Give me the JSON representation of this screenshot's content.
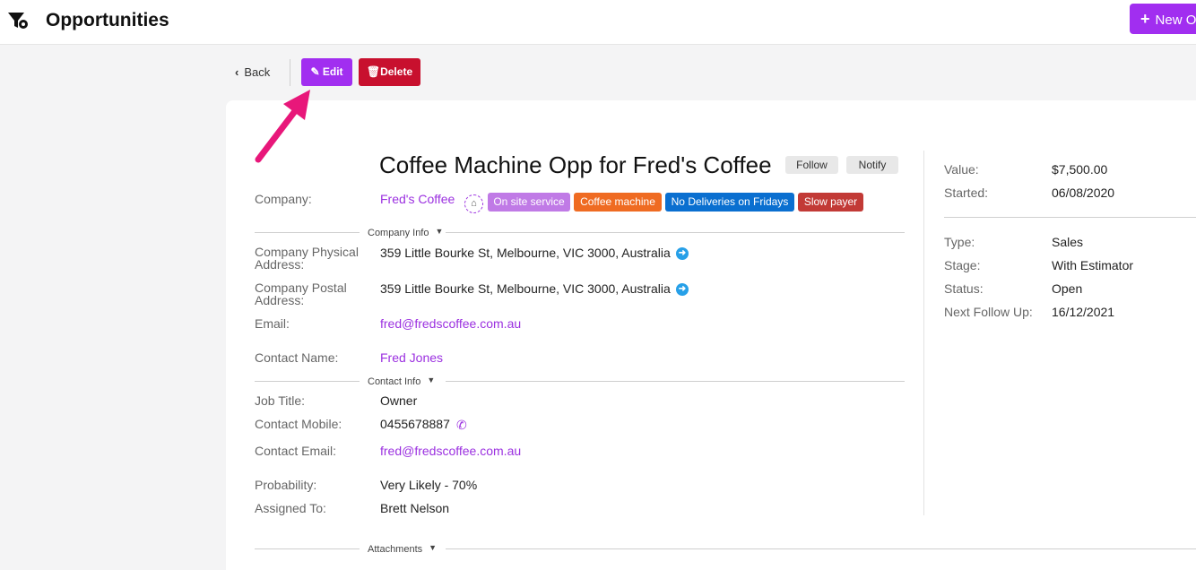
{
  "header": {
    "title": "Opportunities",
    "new_button_label": "New O",
    "icon": "funnel-icon"
  },
  "actions": {
    "back_label": "Back",
    "edit_label": "Edit",
    "delete_label": "Delete"
  },
  "opportunity": {
    "title": "Coffee Machine Opp for Fred's Coffee",
    "follow_label": "Follow",
    "notify_label": "Notify",
    "company_label": "Company:",
    "company": "Fred's Coffee",
    "tags": [
      {
        "label": "On site service",
        "color": "#c07ae6"
      },
      {
        "label": "Coffee machine",
        "color": "#ef6b22"
      },
      {
        "label": "No Deliveries on Fridays",
        "color": "#0a6fd0"
      },
      {
        "label": "Slow payer",
        "color": "#c23a36"
      }
    ],
    "sections": {
      "company_info": "Company Info",
      "contact_info": "Contact Info",
      "attachments": "Attachments"
    },
    "fields": {
      "physical_address_label": "Company Physical Address:",
      "physical_address": "359 Little Bourke St, Melbourne, VIC 3000, Australia",
      "postal_address_label": "Company Postal Address:",
      "postal_address": "359 Little Bourke St, Melbourne, VIC 3000, Australia",
      "email_label": "Email:",
      "email": "fred@fredscoffee.com.au",
      "contact_name_label": "Contact Name:",
      "contact_name": "Fred Jones",
      "job_title_label": "Job Title:",
      "job_title": "Owner",
      "contact_mobile_label": "Contact Mobile:",
      "contact_mobile": "0455678887",
      "contact_email_label": "Contact Email:",
      "contact_email": "fred@fredscoffee.com.au",
      "probability_label": "Probability:",
      "probability": "Very Likely - 70%",
      "assigned_to_label": "Assigned To:",
      "assigned_to": "Brett Nelson"
    },
    "summary": {
      "value_label": "Value:",
      "value": "$7,500.00",
      "started_label": "Started:",
      "started": "06/08/2020",
      "type_label": "Type:",
      "type": "Sales",
      "stage_label": "Stage:",
      "stage": "With Estimator",
      "status_label": "Status:",
      "status": "Open",
      "next_follow_up_label": "Next Follow Up:",
      "next_follow_up": "16/12/2021"
    }
  },
  "colors": {
    "accent": "#a12ef0",
    "danger": "#c8102e",
    "link": "#9b30e0",
    "annotation_arrow": "#e8177a"
  }
}
